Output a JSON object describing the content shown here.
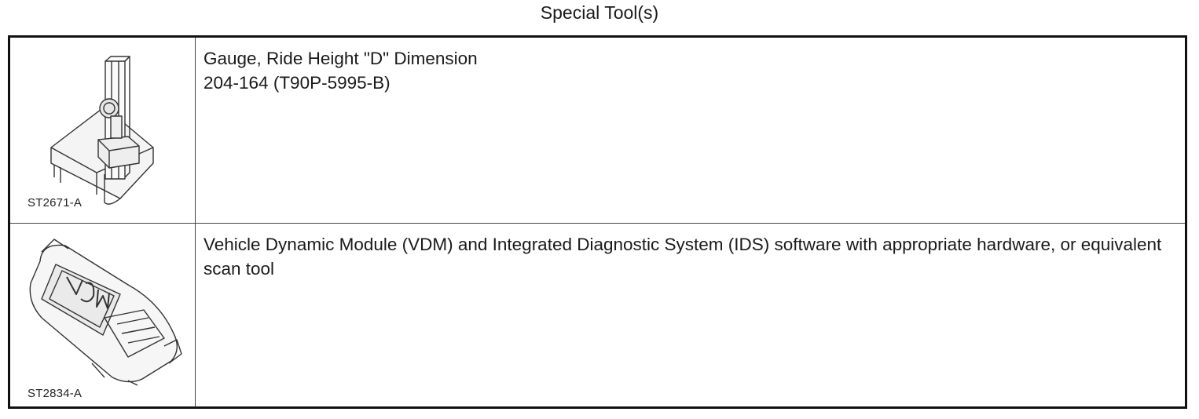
{
  "page": {
    "title": "Special Tool(s)"
  },
  "tools": [
    {
      "image_code": "ST2671-A",
      "image_icon": "ride-height-gauge-illustration",
      "name": "Gauge, Ride Height \"D\" Dimension",
      "part_number": "204-164 (T90P-5995-B)"
    },
    {
      "image_code": "ST2834-A",
      "image_icon": "vdm-module-illustration",
      "name": "Vehicle Dynamic Module (VDM) and Integrated Diagnostic System (IDS) software with appropriate hardware, or equivalent scan tool"
    }
  ]
}
